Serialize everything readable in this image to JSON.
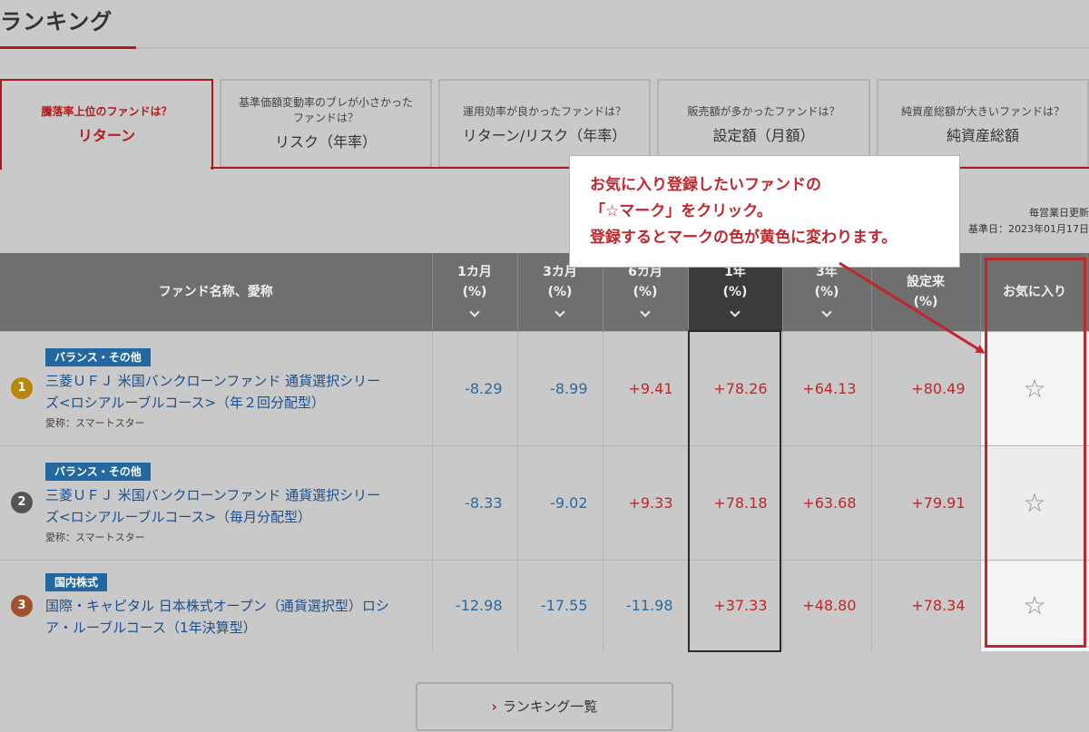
{
  "page": {
    "title": "ランキング"
  },
  "tabs": [
    {
      "question": "騰落率上位のファンドは？",
      "metric": "リターン",
      "active": true
    },
    {
      "question": "基準価額変動率のブレが小さかったファンドは？",
      "metric": "リスク（年率）",
      "active": false
    },
    {
      "question": "運用効率が良かったファンドは？",
      "metric": "リターン/リスク（年率）",
      "active": false
    },
    {
      "question": "販売額が多かったファンドは？",
      "metric": "設定額（月額）",
      "active": false
    },
    {
      "question": "純資産総額が大きいファンドは？",
      "metric": "純資産総額",
      "active": false
    }
  ],
  "update_note": {
    "line1": "毎営業日更新",
    "line2": "基準日：2023年01月17日"
  },
  "callout": {
    "line1": "お気に入り登録したいファンドの",
    "line2": "「☆マーク」をクリック。",
    "line3": "登録するとマークの色が黄色に変わります。"
  },
  "table": {
    "headers": {
      "fund": "ファンド名称、愛称",
      "m1_top": "1カ月",
      "m1_bottom": "(%)",
      "m3_top": "3カ月",
      "m3_bottom": "(%)",
      "m6_top": "6カ月",
      "m6_bottom": "(%)",
      "y1_top": "1年",
      "y1_bottom": "(%)",
      "y3_top": "3年",
      "y3_bottom": "(%)",
      "since_top": "設定来",
      "since_bottom": "(%)",
      "fav": "お気に入り"
    },
    "rows": [
      {
        "rank": "1",
        "category": "バランス・その他",
        "name_line1": "三菱ＵＦＪ 米国バンクローンファンド 通貨選択シリー",
        "name_line2": "ズ<ロシアルーブルコース>（年２回分配型）",
        "nickname": "愛称：スマートスター",
        "m1": "-8.29",
        "m3": "-8.99",
        "m6": "+9.41",
        "y1": "+78.26",
        "y3": "+64.13",
        "since": "+80.49",
        "star": "☆"
      },
      {
        "rank": "2",
        "category": "バランス・その他",
        "name_line1": "三菱ＵＦＪ 米国バンクローンファンド 通貨選択シリー",
        "name_line2": "ズ<ロシアルーブルコース>（毎月分配型）",
        "nickname": "愛称：スマートスター",
        "m1": "-8.33",
        "m3": "-9.02",
        "m6": "+9.33",
        "y1": "+78.18",
        "y3": "+63.68",
        "since": "+79.91",
        "star": "☆"
      },
      {
        "rank": "3",
        "category": "国内株式",
        "name_line1": "国際・キャピタル 日本株式オープン（通貨選択型）ロシ",
        "name_line2": "ア・ルーブルコース（1年決算型）",
        "nickname": "",
        "m1": "-12.98",
        "m3": "-17.55",
        "m6": "-11.98",
        "y1": "+37.33",
        "y3": "+48.80",
        "since": "+78.34",
        "star": "☆"
      }
    ]
  },
  "more_button": {
    "label": "ランキング一覧",
    "caret": "›"
  },
  "colors": {
    "accent_red": "#b01c1c",
    "positive": "#c22626",
    "negative": "#2a6a9f",
    "category_badge": "#2368a0",
    "rank1": "#b8860b",
    "rank2": "#555555",
    "rank3": "#a0522d"
  }
}
